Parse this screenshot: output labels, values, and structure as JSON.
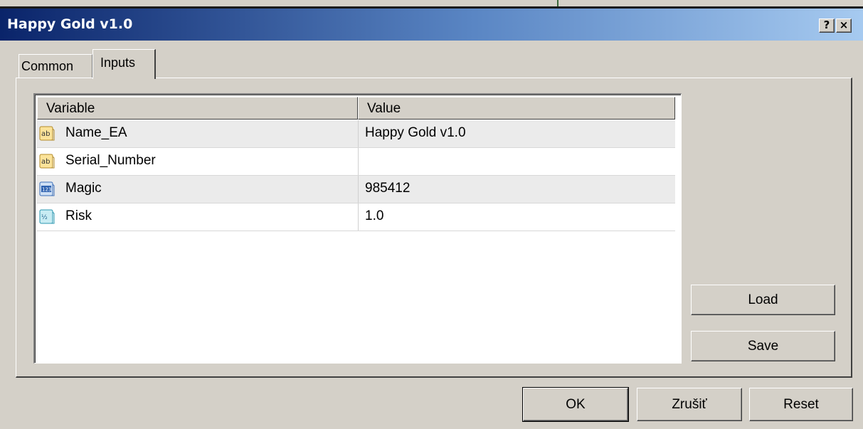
{
  "window": {
    "title": "Happy Gold v1.0",
    "help_label": "?",
    "close_label": "×"
  },
  "tabs": [
    {
      "label": "Common"
    },
    {
      "label": "Inputs"
    }
  ],
  "grid": {
    "columns": [
      "Variable",
      "Value"
    ],
    "rows": [
      {
        "icon": "string-param-icon",
        "variable": "Name_EA",
        "value": "Happy Gold v1.0"
      },
      {
        "icon": "string-param-icon",
        "variable": "Serial_Number",
        "value": ""
      },
      {
        "icon": "integer-param-icon",
        "variable": "Magic",
        "value": "985412"
      },
      {
        "icon": "double-param-icon",
        "variable": "Risk",
        "value": "1.0"
      }
    ]
  },
  "side_buttons": {
    "load": "Load",
    "save": "Save"
  },
  "footer_buttons": {
    "ok": "OK",
    "cancel": "Zrušiť",
    "reset": "Reset"
  },
  "colors": {
    "title_gradient_start": "#0a246a",
    "title_gradient_end": "#a6caf0",
    "face": "#d4d0c8"
  }
}
